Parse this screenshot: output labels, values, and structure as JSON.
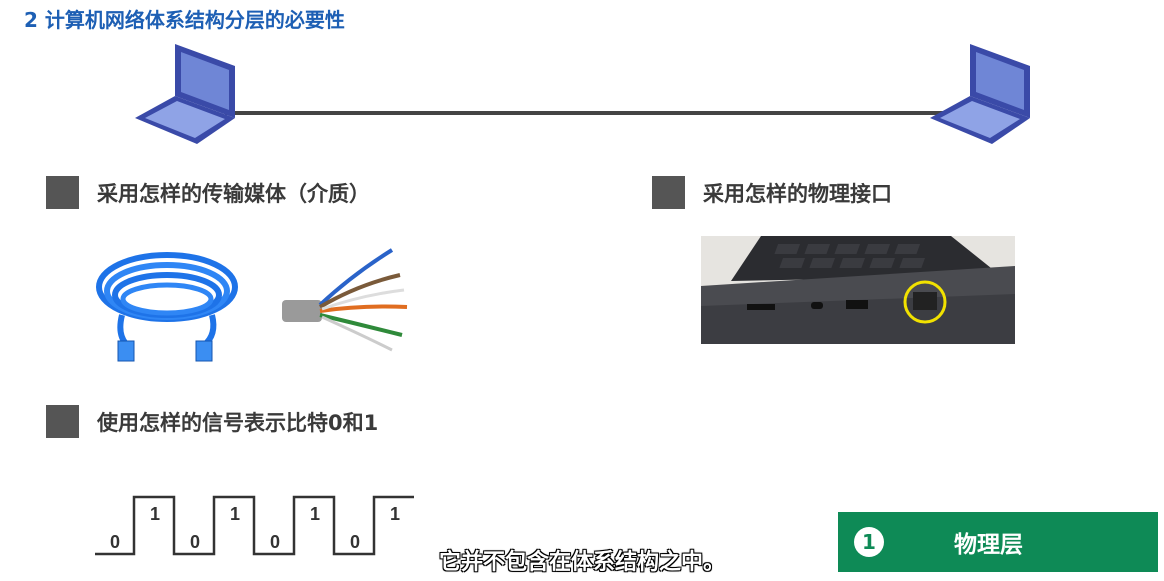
{
  "title": "2 计算机网络体系结构分层的必要性",
  "items": {
    "medium": "采用怎样的传输媒体（介质）",
    "interface": "采用怎样的物理接口",
    "signal": "使用怎样的信号表示比特0和1"
  },
  "signal_bits": [
    "0",
    "1",
    "0",
    "1",
    "0",
    "1",
    "0",
    "1"
  ],
  "layer": {
    "number": "1",
    "label": "物理层",
    "color": "#0e8a56"
  },
  "subtitle": "它并不包含在体系结构之中。",
  "icons": [
    "laptop-icon",
    "ethernet-cable-image",
    "twisted-pair-wires-image",
    "laptop-ethernet-port-image"
  ]
}
